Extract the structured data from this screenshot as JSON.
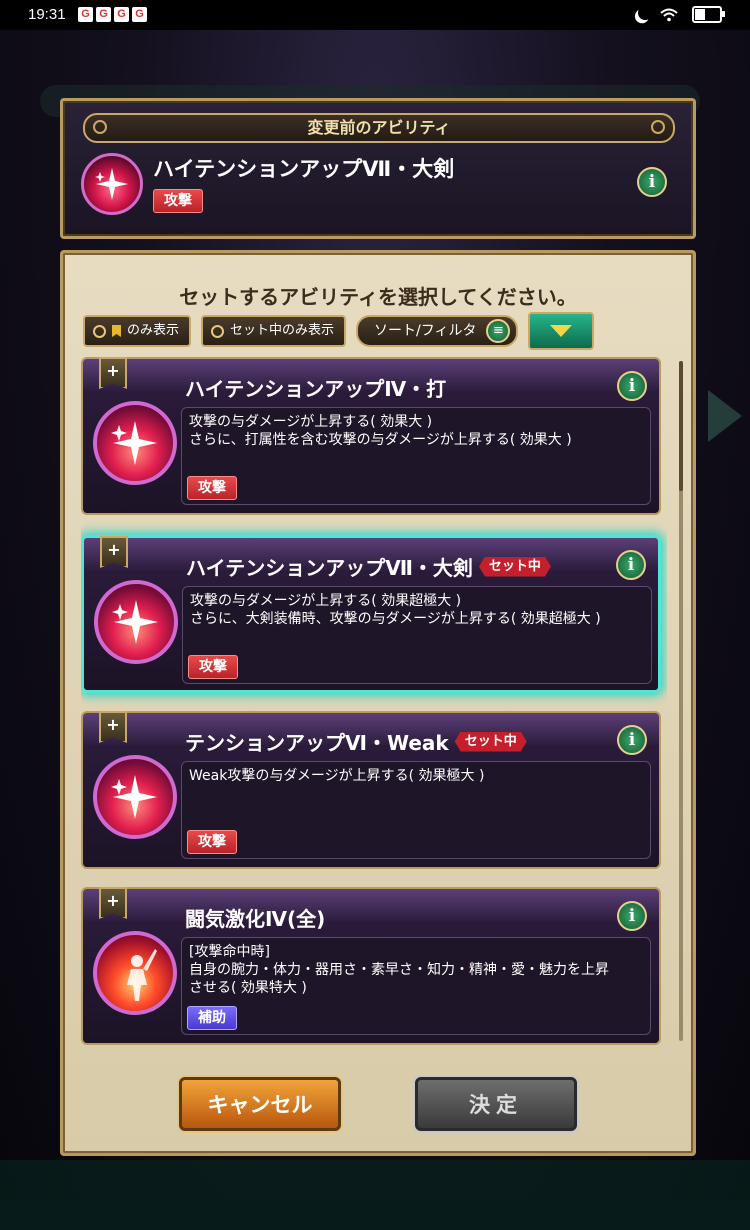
{
  "status_bar": {
    "time": "19:31",
    "notification_icons": [
      "G",
      "G",
      "G",
      "G"
    ]
  },
  "before_panel": {
    "title": "変更前のアビリティ",
    "ability_name": "ハイテンションアップⅦ・大剣",
    "tag": "攻撃",
    "info_label": "i"
  },
  "main": {
    "instruction": "セットするアビリティを選択してください。",
    "filter_bookmark_only": "のみ表示",
    "filter_set_only": "セット中のみ表示",
    "sort_filter": "ソート/フィルタ",
    "abilities": [
      {
        "name": "ハイテンションアップⅣ・打",
        "set_badge": "",
        "desc": [
          "攻撃の与ダメージが上昇する( 効果大 )",
          "さらに、打属性を含む攻撃の与ダメージが上昇する( 効果大 )"
        ],
        "tag": "攻撃",
        "tag_type": "atk",
        "selected": false
      },
      {
        "name": "ハイテンションアップⅦ・大剣",
        "set_badge": "セット中",
        "desc": [
          "攻撃の与ダメージが上昇する( 効果超極大 )",
          "さらに、大剣装備時、攻撃の与ダメージが上昇する( 効果超極大 )"
        ],
        "tag": "攻撃",
        "tag_type": "atk",
        "selected": true
      },
      {
        "name": "テンションアップⅥ・Weak",
        "set_badge": "セット中",
        "desc": [
          "Weak攻撃の与ダメージが上昇する( 効果極大 )"
        ],
        "tag": "攻撃",
        "tag_type": "atk",
        "selected": false
      },
      {
        "name": "闘気激化Ⅳ(全)",
        "set_badge": "",
        "desc": [
          "[攻撃命中時]",
          "自身の腕力・体力・器用さ・素早さ・知力・精神・愛・魅力を上昇",
          "させる( 効果特大 )"
        ],
        "tag": "補助",
        "tag_type": "sup",
        "selected": false
      }
    ],
    "cancel_label": "キャンセル",
    "decide_label": "決定"
  },
  "colors": {
    "selected_glow": "#4ee6d6",
    "attack_tag": "#d8333a",
    "support_tag": "#5a4ae0",
    "panel_bg": "#e2d6b8"
  }
}
